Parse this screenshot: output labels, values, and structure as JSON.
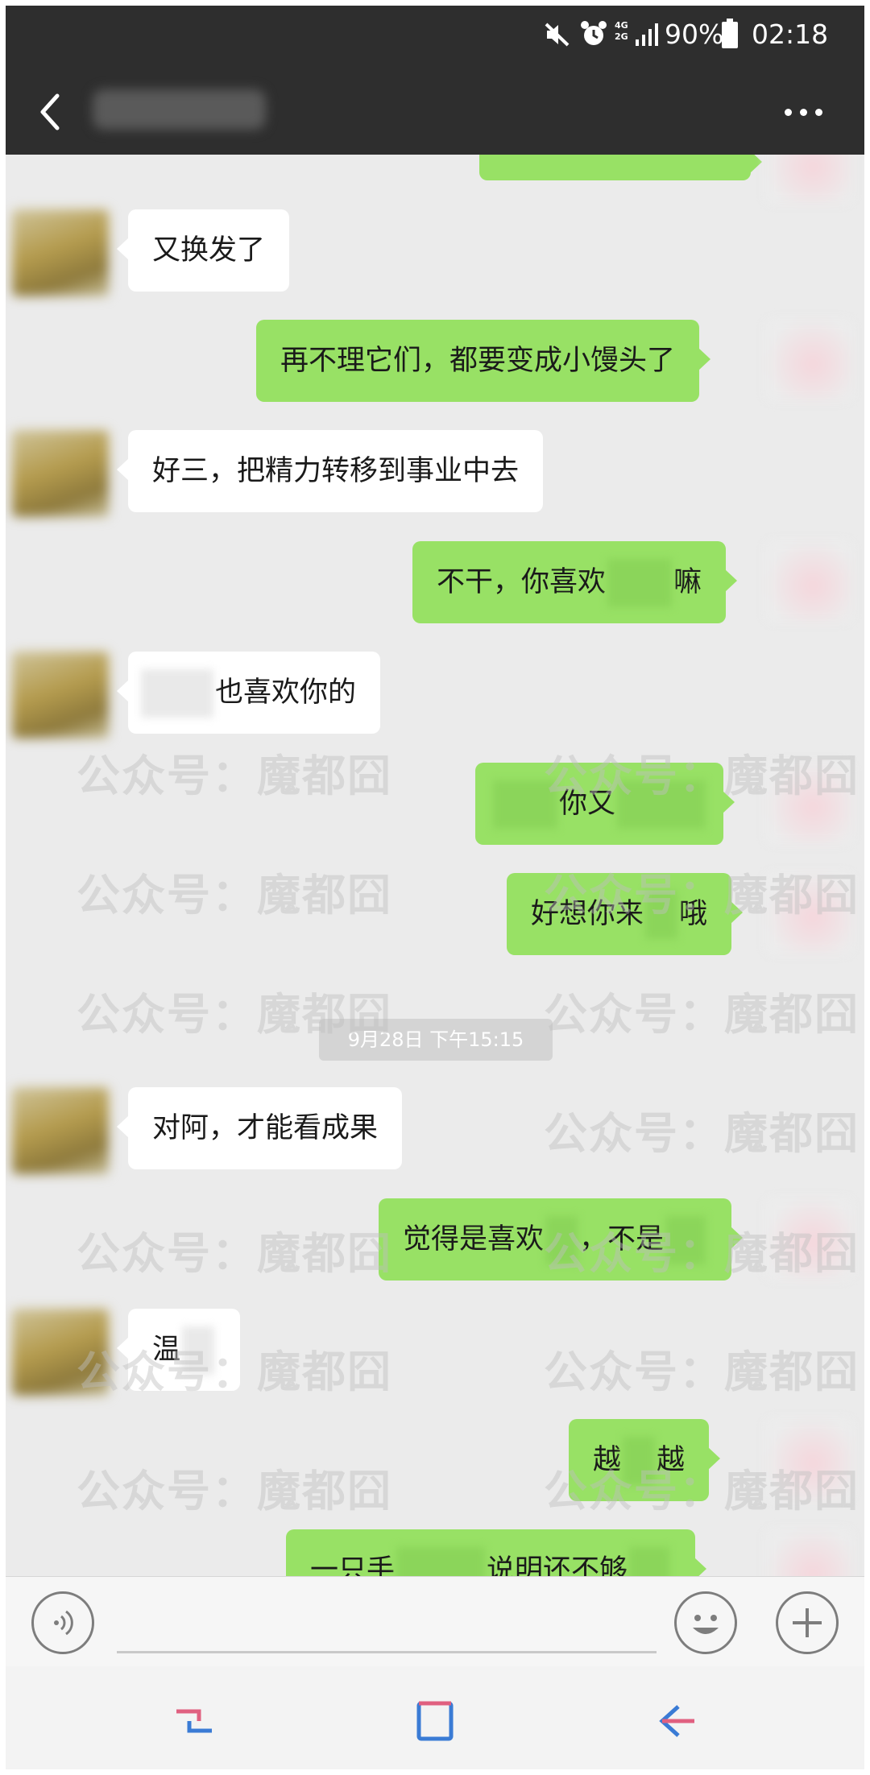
{
  "status_bar": {
    "network": "4G 2G",
    "battery": "90%",
    "time": "02:18",
    "icons": [
      "mute-icon",
      "alarm-icon",
      "signal-icon",
      "battery-icon"
    ]
  },
  "header": {
    "contact_name": "",
    "back_icon": "chevron-left-icon",
    "more_icon": "more-dots-icon"
  },
  "messages": [
    {
      "side": "out",
      "text": "…"
    },
    {
      "side": "in",
      "text": "又换发了"
    },
    {
      "side": "out",
      "text": "再不理它们，都要变成小馒头了"
    },
    {
      "side": "in",
      "text": "好三，把精力转移到事业中去"
    },
    {
      "side": "out",
      "text_before": "不干，你喜欢",
      "text_after": "嘛"
    },
    {
      "side": "in",
      "text_after": "也喜欢你的"
    },
    {
      "side": "out",
      "text_mid": "你又"
    },
    {
      "side": "out",
      "text_before": "好想你来",
      "text_after": "哦"
    },
    {
      "side": "in",
      "text": "对阿，才能看成果"
    },
    {
      "side": "out",
      "text_before": "觉得是喜欢",
      "text_mid": "，不是"
    },
    {
      "side": "in",
      "text_before": "温"
    },
    {
      "side": "out",
      "text_before": "越",
      "text_after": "越"
    },
    {
      "side": "out",
      "text_before": "一只手",
      "text_mid": "说明还不够"
    }
  ],
  "timestamp": "9月28日 下午15:15",
  "watermark": "公众号：魔都囧",
  "input_bar": {
    "voice_icon": "voice-icon",
    "emoji_icon": "emoji-icon",
    "add_icon": "plus-icon",
    "placeholder": ""
  },
  "nav_bar": {
    "recents_icon": "recents-icon",
    "home_icon": "home-icon",
    "back_icon": "back-arrow-icon"
  }
}
